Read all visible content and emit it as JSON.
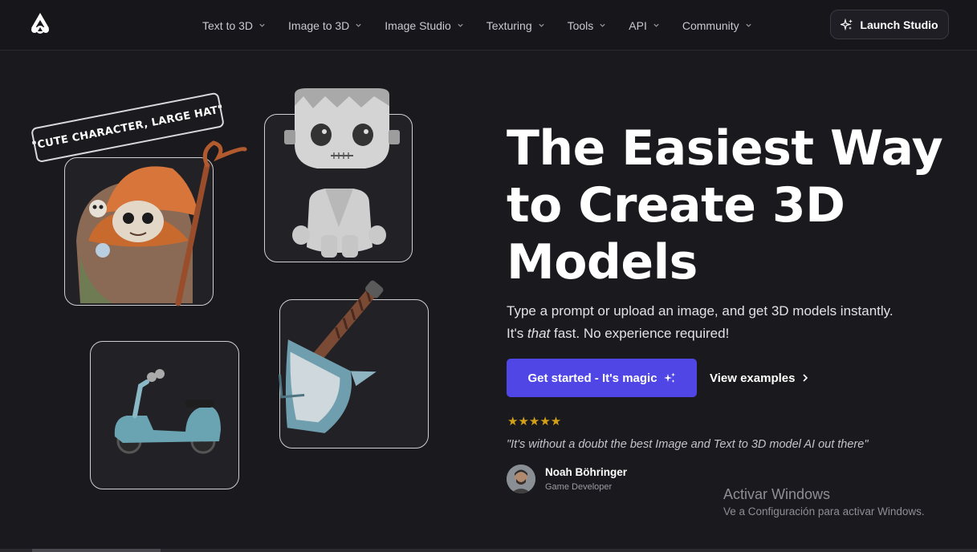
{
  "nav": {
    "items": [
      {
        "label": "Text to 3D"
      },
      {
        "label": "Image to 3D"
      },
      {
        "label": "Image Studio"
      },
      {
        "label": "Texturing"
      },
      {
        "label": "Tools"
      },
      {
        "label": "API"
      },
      {
        "label": "Community"
      }
    ],
    "launch_label": "Launch Studio"
  },
  "art": {
    "prompt_tag": "\"CUTE CHARACTER, LARGE HAT\""
  },
  "hero": {
    "headline_1": "The Easiest Way",
    "headline_2": "to Create 3D",
    "headline_3": "Models",
    "sub_line1": "Type a prompt or upload an image, and get 3D models instantly.",
    "sub_line2_a": "It's ",
    "sub_line2_em": "that",
    "sub_line2_b": " fast. No experience required!",
    "cta_label": "Get started - It's magic",
    "examples_label": "View examples"
  },
  "testimonial": {
    "rating": 5,
    "stars": "★★★★★",
    "quote": "\"It's without a doubt the best Image and Text to 3D model AI out there\"",
    "author": "Noah Böhringer",
    "role": "Game Developer"
  },
  "watermark": {
    "title": "Activar Windows",
    "subtitle": "Ve a Configuración para activar Windows."
  },
  "colors": {
    "background": "#1a191e",
    "accent": "#4f46e5",
    "star": "#d4a017"
  }
}
